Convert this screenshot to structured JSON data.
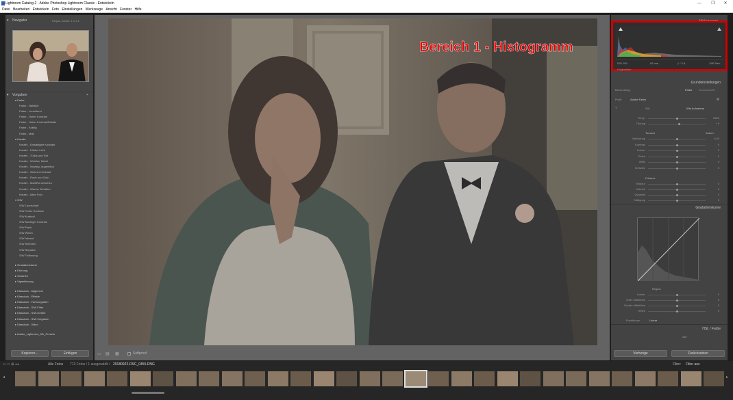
{
  "window": {
    "title": "Lightroom Catalog-2 - Adobe Photoshop Lightroom Classic - Entwickeln",
    "minimize": "—",
    "maximize": "❐",
    "close": "✕"
  },
  "menu": [
    "Datei",
    "Bearbeiten",
    "Entwickeln",
    "Foto",
    "Einstellungen",
    "Werkzeuge",
    "Ansicht",
    "Fenster",
    "Hilfe"
  ],
  "navigator": {
    "title": "Navigator",
    "zoom_options": "Einpas.   Ausfül.   1:1   3:1"
  },
  "presets": {
    "title": "Vorgaben",
    "groups": [
      {
        "name": "Farbe",
        "items": [
          "Farbe - Nahtlich",
          "Farbe - Leuchtend",
          "Farbe - Hoher Kontrast",
          "Farbe - Hoher Kontrast/Details",
          "Farbe - Kräftig",
          "Farbe - Matt"
        ]
      },
      {
        "name": "Kreativ",
        "items": [
          "Kreativ - Entsättigter Kontrast",
          "Kreativ - Kühles Licht",
          "Kreativ - Türkis und Rot",
          "Kreativ - Weicher Nebel",
          "Kreativ - Nostalg. Augenblick",
          "Kreativ - Warmer Kontrast",
          "Kreativ - Flach und Grün",
          "Kreativ - Matt/Rot Anheben",
          "Kreativ - Warme Schatten",
          "Kreativ - Altes Foto"
        ]
      },
      {
        "name": "S/W",
        "items": [
          "S/W Landschaft",
          "S/W Hoher Kontrast",
          "S/W Kraftvoll",
          "S/W Niedriger Kontrast",
          "S/W Flach",
          "S/W Weich",
          "S/W Infrarot",
          "S/W Selenton",
          "S/W Sepiaton",
          "S/W Teiltonung"
        ]
      }
    ],
    "collapsed": [
      "Gradationskurve",
      "Körnung",
      "Schärfen",
      "Vignettierung",
      "Klassisch - Allgemein",
      "Klassisch - Effekte",
      "Klassisch - Farbvorgaben",
      "Klassisch - S/W-Filter",
      "Klassisch - S/W-Getönt",
      "Klassisch - S/W-Vorgaben",
      "Klassisch - Video",
      "Adobe_Lightroom_Klk_Presets"
    ]
  },
  "left_buttons": {
    "copy": "Kopieren...",
    "paste": "Einfügen"
  },
  "toolbar": {
    "softproof": "Softproof"
  },
  "annotation": {
    "text": "Bereich 1 - Histogramm"
  },
  "histogram": {
    "title": "Histogramm",
    "info": [
      "ISO 100",
      "62 mm",
      "ƒ / 2,8",
      "1/80 Sek."
    ],
    "original": "Originalfoto"
  },
  "basic": {
    "title": "Grundeinstellungen",
    "treatment_label": "Behandlung:",
    "treatment_color": "Farbe",
    "treatment_bw": "Schwarzweiß",
    "profile_label": "Profil:",
    "profile_value": "Adobe Farbe",
    "wb_label": "WA:",
    "wb_value": "Wie Aufnahme",
    "wb_sliders": [
      {
        "label": "Temp.",
        "value": "5400",
        "pos": 0.5
      },
      {
        "label": "Tönung",
        "value": "+ 9",
        "pos": 0.54
      }
    ],
    "tone_label": "Tonwert",
    "tone_auto": "Autom.",
    "tone_sliders": [
      {
        "label": "Belichtung",
        "value": "0,00",
        "pos": 0.5
      },
      {
        "label": "Kontrast",
        "value": "0",
        "pos": 0.5
      },
      {
        "label": "Lichter",
        "value": "0",
        "pos": 0.5
      },
      {
        "label": "Tiefen",
        "value": "0",
        "pos": 0.5
      },
      {
        "label": "Weiß",
        "value": "0",
        "pos": 0.5
      },
      {
        "label": "Schwarz",
        "value": "0",
        "pos": 0.5
      }
    ],
    "presence_label": "Präsenz",
    "presence_sliders": [
      {
        "label": "Struktur",
        "value": "0",
        "pos": 0.5
      },
      {
        "label": "Klarheit",
        "value": "0",
        "pos": 0.5
      },
      {
        "label": "Dynamik",
        "value": "0",
        "pos": 0.5
      },
      {
        "label": "Sättigung",
        "value": "0",
        "pos": 0.5
      }
    ]
  },
  "tone_curve": {
    "title": "Gradationskurve",
    "region_label": "Region",
    "sliders": [
      {
        "label": "Lichter",
        "value": "0",
        "pos": 0.5
      },
      {
        "label": "Helle Mitteltöne",
        "value": "0",
        "pos": 0.5
      },
      {
        "label": "Dunkle Mitteltöne",
        "value": "0",
        "pos": 0.5
      },
      {
        "label": "Tiefen",
        "value": "0",
        "pos": 0.5
      }
    ],
    "point_curve_label": "Punktkurve:",
    "point_curve_value": "Linear"
  },
  "hsl": {
    "title": "HSL / Farbe",
    "tab": "Alle"
  },
  "right_buttons": {
    "previous": "Vorherige",
    "reset": "Zurücksetzen"
  },
  "filmstrip": {
    "source": "Alle Fotos",
    "count": "713 Fotos / 1 ausgewählt /",
    "filename": "20180922-DSC_0455.DNG",
    "filter_label": "Filter:",
    "filter_value": "Filter aus"
  },
  "colors": {
    "accent_red": "#d10000",
    "panel": "#454545",
    "background": "#1f1f1f"
  }
}
